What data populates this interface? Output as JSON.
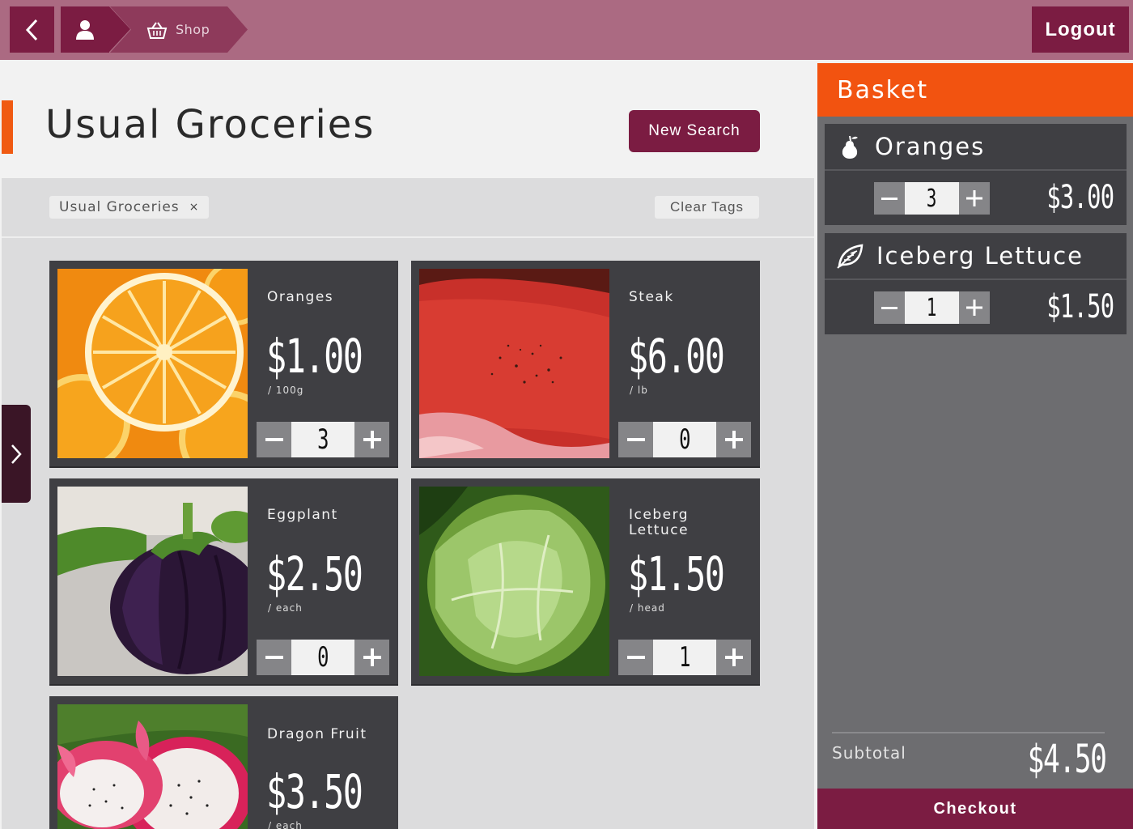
{
  "topbar": {
    "back_icon": "chevron-left-icon",
    "user_icon": "user-icon",
    "shop_icon": "basket-icon",
    "shop_label": "Shop",
    "logout_label": "Logout"
  },
  "header": {
    "title": "Usual Groceries",
    "new_search_label": "New Search"
  },
  "tags": {
    "items": [
      {
        "label": "Usual Groceries",
        "remove": "×"
      }
    ],
    "clear_label": "Clear Tags"
  },
  "products": [
    {
      "name": "Oranges",
      "price": "$1.00",
      "unit": "/ 100g",
      "qty": "3"
    },
    {
      "name": "Steak",
      "price": "$6.00",
      "unit": "/ lb",
      "qty": "0"
    },
    {
      "name": "Eggplant",
      "price": "$2.50",
      "unit": "/ each",
      "qty": "0"
    },
    {
      "name": "Iceberg Lettuce",
      "price": "$1.50",
      "unit": "/ head",
      "qty": "1"
    },
    {
      "name": "Dragon Fruit",
      "price": "$3.50",
      "unit": "/ each",
      "qty": ""
    }
  ],
  "basket": {
    "title": "Basket",
    "items": [
      {
        "name": "Oranges",
        "icon": "pear-icon",
        "qty": "3",
        "price": "$3.00"
      },
      {
        "name": "Iceberg Lettuce",
        "icon": "leaf-icon",
        "qty": "1",
        "price": "$1.50"
      }
    ],
    "subtotal_label": "Subtotal",
    "subtotal_value": "$4.50",
    "checkout_label": "Checkout"
  },
  "colors": {
    "topbar": "#ab6a82",
    "brand": "#7b1c42",
    "accent": "#f25310",
    "card": "#3f3f43",
    "basket_bg": "#6d6d70"
  }
}
